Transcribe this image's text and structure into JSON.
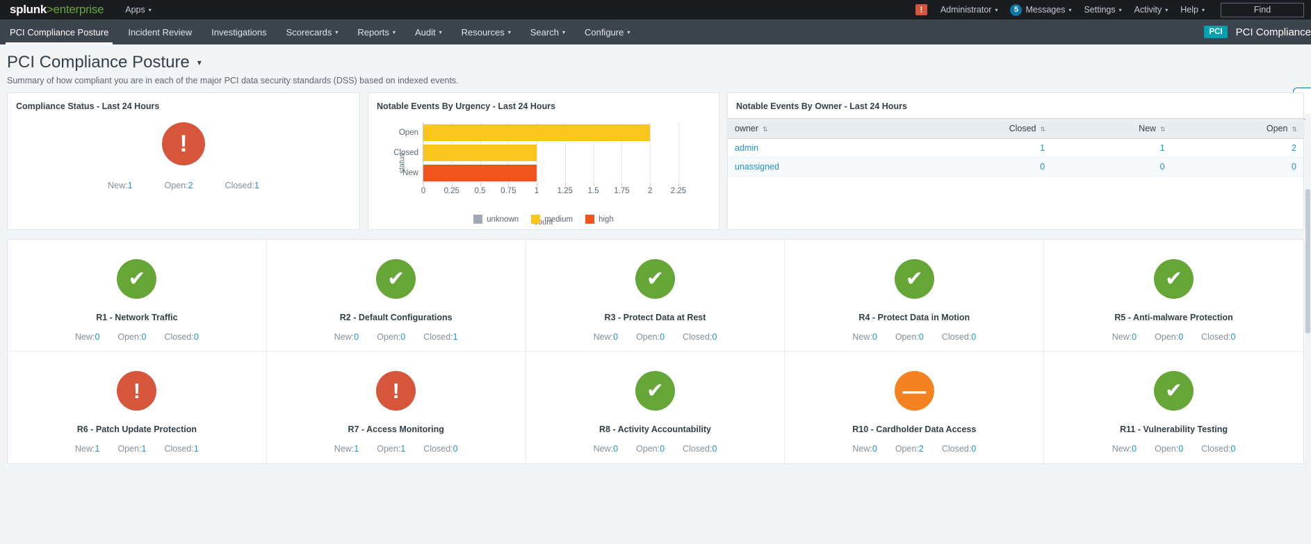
{
  "appbar": {
    "logo_main": "splunk",
    "logo_gt": ">",
    "logo_sub": "enterprise",
    "apps_label": "Apps",
    "alert_icon": "alert-exclamation-icon",
    "alert_symbol": "!",
    "user_label": "Administrator",
    "messages_count": "5",
    "messages_label": "Messages",
    "settings_label": "Settings",
    "activity_label": "Activity",
    "help_label": "Help",
    "find_label": "Find",
    "caret": "▾",
    "colors": {
      "bg": "#1a1c20",
      "accent_green": "#65a637",
      "badge_blue": "#0877a6",
      "alert_red": "#d6563c"
    }
  },
  "navbar": {
    "items": [
      {
        "label": "PCI Compliance Posture",
        "has_caret": false,
        "active": true
      },
      {
        "label": "Incident Review",
        "has_caret": false,
        "active": false
      },
      {
        "label": "Investigations",
        "has_caret": false,
        "active": false
      },
      {
        "label": "Scorecards",
        "has_caret": true,
        "active": false
      },
      {
        "label": "Reports",
        "has_caret": true,
        "active": false
      },
      {
        "label": "Audit",
        "has_caret": true,
        "active": false
      },
      {
        "label": "Resources",
        "has_caret": true,
        "active": false
      },
      {
        "label": "Search",
        "has_caret": true,
        "active": false
      },
      {
        "label": "Configure",
        "has_caret": true,
        "active": false
      }
    ],
    "app_badge": "PCI",
    "app_name": "PCI Compliance",
    "caret": "▾",
    "colors": {
      "bg": "#3c444d",
      "badge_teal": "#00a0b0"
    }
  },
  "page": {
    "title": "PCI Compliance Posture",
    "title_caret": "▾",
    "description": "Summary of how compliant you are in each of the major PCI data security standards (DSS) based on indexed events.",
    "collapse_icon": "chevron-left-icon",
    "collapse_glyph": "‹"
  },
  "compliance_status": {
    "title": "Compliance Status - Last 24 Hours",
    "status_symbol": "!",
    "status_color": "#d6563c",
    "status_icon": "alert-circle-icon",
    "deltas": [
      {
        "label": "New:",
        "value": "1"
      },
      {
        "label": "Open:",
        "value": "2"
      },
      {
        "label": "Closed:",
        "value": "1"
      }
    ]
  },
  "urgency_panel": {
    "title": "Notable Events By Urgency - Last 24 Hours"
  },
  "owner_panel": {
    "title": "Notable Events By Owner - Last 24 Hours",
    "sort_glyph": "⇅",
    "columns": [
      {
        "label": "owner",
        "align": "left"
      },
      {
        "label": "Closed",
        "align": "right"
      },
      {
        "label": "New",
        "align": "right"
      },
      {
        "label": "Open",
        "align": "right"
      }
    ],
    "rows": [
      {
        "owner": "admin",
        "closed": "1",
        "new": "1",
        "open": "2"
      },
      {
        "owner": "unassigned",
        "closed": "0",
        "new": "0",
        "open": "0"
      }
    ]
  },
  "chart_data": {
    "type": "bar",
    "orientation": "horizontal",
    "title": "Notable Events By Urgency - Last 24 Hours",
    "categories": [
      "Open",
      "Closed",
      "New"
    ],
    "series": [
      {
        "name": "unknown",
        "color": "#9fa8b4",
        "values": [
          0,
          0,
          0
        ]
      },
      {
        "name": "medium",
        "color": "#fac51c",
        "values": [
          2,
          1,
          0
        ]
      },
      {
        "name": "high",
        "color": "#f1541a",
        "values": [
          0,
          0,
          1
        ]
      }
    ],
    "bar_values": [
      {
        "category": "Open",
        "value": 2,
        "series": "medium",
        "color": "#fac51c"
      },
      {
        "category": "Closed",
        "value": 1,
        "series": "medium",
        "color": "#fac51c"
      },
      {
        "category": "New",
        "value": 1,
        "series": "high",
        "color": "#f1541a"
      }
    ],
    "xlabel": "count",
    "ylabel": "status",
    "xlim": [
      0,
      2.25
    ],
    "xticks": [
      "0",
      "0.25",
      "0.5",
      "0.75",
      "1",
      "1.25",
      "1.5",
      "1.75",
      "2",
      "2.25"
    ],
    "xtick_values": [
      0,
      0.25,
      0.5,
      0.75,
      1,
      1.25,
      1.5,
      1.75,
      2,
      2.25
    ],
    "grid": true,
    "legend": [
      "unknown",
      "medium",
      "high"
    ],
    "legend_position": "bottom"
  },
  "requirement_cards": [
    {
      "label": "R1 - Network Traffic",
      "icon": "check-circle-icon",
      "glyph": "✔",
      "shape": "check",
      "color": "#65a637",
      "deltas": [
        {
          "label": "New:",
          "value": "0"
        },
        {
          "label": "Open:",
          "value": "0"
        },
        {
          "label": "Closed:",
          "value": "0"
        }
      ]
    },
    {
      "label": "R2 - Default Configurations",
      "icon": "check-circle-icon",
      "glyph": "✔",
      "shape": "check",
      "color": "#65a637",
      "deltas": [
        {
          "label": "New:",
          "value": "0"
        },
        {
          "label": "Open:",
          "value": "0"
        },
        {
          "label": "Closed:",
          "value": "1"
        }
      ]
    },
    {
      "label": "R3 - Protect Data at Rest",
      "icon": "check-circle-icon",
      "glyph": "✔",
      "shape": "check",
      "color": "#65a637",
      "deltas": [
        {
          "label": "New:",
          "value": "0"
        },
        {
          "label": "Open:",
          "value": "0"
        },
        {
          "label": "Closed:",
          "value": "0"
        }
      ]
    },
    {
      "label": "R4 - Protect Data in Motion",
      "icon": "check-circle-icon",
      "glyph": "✔",
      "shape": "check",
      "color": "#65a637",
      "deltas": [
        {
          "label": "New:",
          "value": "0"
        },
        {
          "label": "Open:",
          "value": "0"
        },
        {
          "label": "Closed:",
          "value": "0"
        }
      ]
    },
    {
      "label": "R5 - Anti-malware Protection",
      "icon": "check-circle-icon",
      "glyph": "✔",
      "shape": "check",
      "color": "#65a637",
      "deltas": [
        {
          "label": "New:",
          "value": "0"
        },
        {
          "label": "Open:",
          "value": "0"
        },
        {
          "label": "Closed:",
          "value": "0"
        }
      ]
    },
    {
      "label": "R6 - Patch Update Protection",
      "icon": "alert-circle-icon",
      "glyph": "!",
      "shape": "alert",
      "color": "#d6563c",
      "deltas": [
        {
          "label": "New:",
          "value": "1"
        },
        {
          "label": "Open:",
          "value": "1"
        },
        {
          "label": "Closed:",
          "value": "1"
        }
      ]
    },
    {
      "label": "R7 - Access Monitoring",
      "icon": "alert-circle-icon",
      "glyph": "!",
      "shape": "alert",
      "color": "#d6563c",
      "deltas": [
        {
          "label": "New:",
          "value": "1"
        },
        {
          "label": "Open:",
          "value": "1"
        },
        {
          "label": "Closed:",
          "value": "0"
        }
      ]
    },
    {
      "label": "R8 - Activity Accountability",
      "icon": "check-circle-icon",
      "glyph": "✔",
      "shape": "check",
      "color": "#65a637",
      "deltas": [
        {
          "label": "New:",
          "value": "0"
        },
        {
          "label": "Open:",
          "value": "0"
        },
        {
          "label": "Closed:",
          "value": "0"
        }
      ]
    },
    {
      "label": "R10 - Cardholder Data Access",
      "icon": "minus-circle-icon",
      "glyph": "—",
      "shape": "dash",
      "color": "#f58220",
      "deltas": [
        {
          "label": "New:",
          "value": "0"
        },
        {
          "label": "Open:",
          "value": "2"
        },
        {
          "label": "Closed:",
          "value": "0"
        }
      ]
    },
    {
      "label": "R11 - Vulnerability Testing",
      "icon": "check-circle-icon",
      "glyph": "✔",
      "shape": "check",
      "color": "#65a637",
      "deltas": [
        {
          "label": "New:",
          "value": "0"
        },
        {
          "label": "Open:",
          "value": "0"
        },
        {
          "label": "Closed:",
          "value": "0"
        }
      ]
    }
  ]
}
